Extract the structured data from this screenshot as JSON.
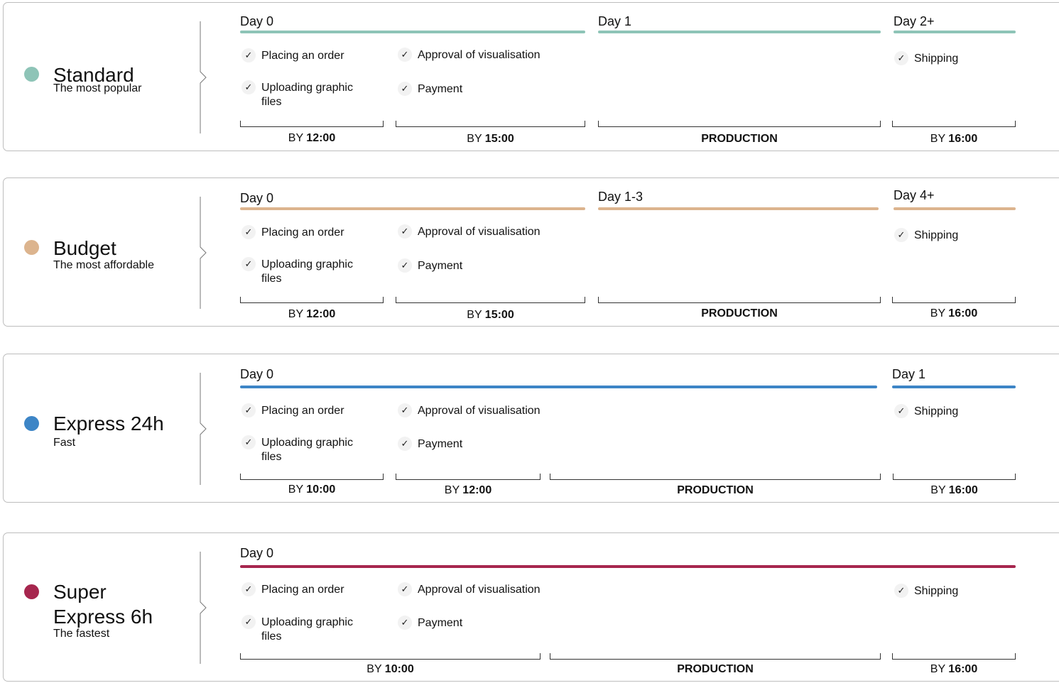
{
  "colors": {
    "standard": "#8ec4b7",
    "budget": "#dcb48e",
    "express24": "#3d85c6",
    "super6": "#a6264e"
  },
  "icons": {
    "check": "check-icon",
    "separator": "chevron-right-icon"
  },
  "plans": [
    {
      "title": "Standard",
      "subtitle": "The most popular",
      "days": [
        "Day 0",
        "Day 1",
        "Day 2+"
      ],
      "tasks": {
        "placing": "Placing an order",
        "uploading": "Uploading graphic files",
        "approval": "Approval of visualisation",
        "payment": "Payment",
        "shipping": "Shipping"
      },
      "deadlines": [
        {
          "prefix": "BY",
          "time": "12:00"
        },
        {
          "prefix": "BY",
          "time": "15:00"
        },
        {
          "prefix": "",
          "time": "PRODUCTION"
        },
        {
          "prefix": "BY",
          "time": "16:00"
        }
      ]
    },
    {
      "title": "Budget",
      "subtitle": "The most affordable",
      "days": [
        "Day 0",
        "Day 1-3",
        "Day 4+"
      ],
      "tasks": {
        "placing": "Placing an order",
        "uploading": "Uploading graphic files",
        "approval": "Approval of visualisation",
        "payment": "Payment",
        "shipping": "Shipping"
      },
      "deadlines": [
        {
          "prefix": "BY",
          "time": "12:00"
        },
        {
          "prefix": "BY",
          "time": "15:00"
        },
        {
          "prefix": "",
          "time": "PRODUCTION"
        },
        {
          "prefix": "BY",
          "time": "16:00"
        }
      ]
    },
    {
      "title": "Express 24h",
      "subtitle": "Fast",
      "days": [
        "Day 0",
        "Day 1"
      ],
      "tasks": {
        "placing": "Placing an order",
        "uploading": "Uploading graphic files",
        "approval": "Approval of visualisation",
        "payment": "Payment",
        "shipping": "Shipping"
      },
      "deadlines": [
        {
          "prefix": "BY",
          "time": "10:00"
        },
        {
          "prefix": "BY",
          "time": "12:00"
        },
        {
          "prefix": "",
          "time": "PRODUCTION"
        },
        {
          "prefix": "BY",
          "time": "16:00"
        }
      ]
    },
    {
      "title": "Super Express 6h",
      "subtitle": "The fastest",
      "days": [
        "Day 0"
      ],
      "tasks": {
        "placing": "Placing an order",
        "uploading": "Uploading graphic files",
        "approval": "Approval of visualisation",
        "payment": "Payment",
        "shipping": "Shipping"
      },
      "deadlines": [
        {
          "prefix": "BY",
          "time": "10:00"
        },
        {
          "prefix": "",
          "time": "PRODUCTION"
        },
        {
          "prefix": "BY",
          "time": "16:00"
        }
      ]
    }
  ]
}
